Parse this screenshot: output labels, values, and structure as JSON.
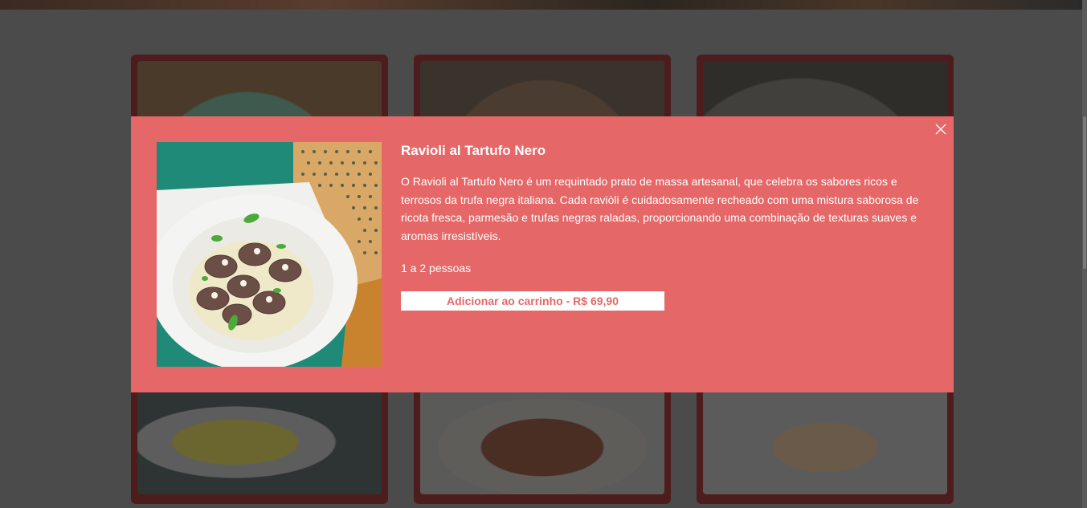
{
  "modal": {
    "title": "Ravioli al Tartufo Nero",
    "description": "O Ravioli al Tartufo Nero é um requintado prato de massa artesanal, que celebra os sabores ricos e terrosos da trufa negra italiana. Cada raviòli é cuidadosamente recheado com uma mistura saborosa de ricota fresca, parmesão e trufas negras raladas, proporcionando uma combinação de texturas suaves e aromas irresistíveis.",
    "serves": "1 a 2 pessoas",
    "add_button_label": "Adicionar ao carrinho - R$ 69,90",
    "image_alt": "ravioli-dish-photo"
  },
  "colors": {
    "modal_bg": "#e56767",
    "button_text": "#e56767",
    "card_bg": "#4d1d1e",
    "overlay": "#4b4b4b"
  },
  "icons": {
    "close": "close-icon"
  }
}
